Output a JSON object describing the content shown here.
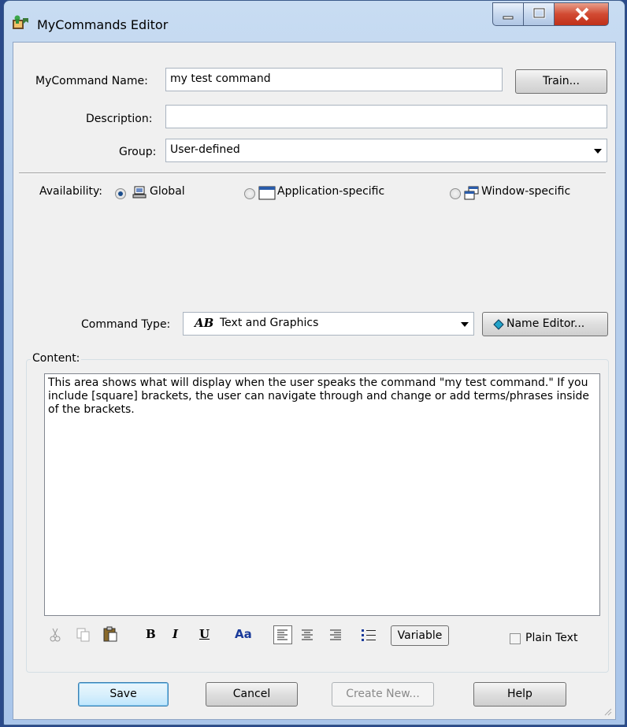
{
  "window": {
    "title": "MyCommands Editor",
    "minimize": "–",
    "maximize": "□",
    "close": "X"
  },
  "form": {
    "name_label": "MyCommand Name:",
    "name_value": "my test command",
    "train_button": "Train...",
    "description_label": "Description:",
    "description_value": "",
    "group_label": "Group:",
    "group_value": "User-defined"
  },
  "availability": {
    "label": "Availability:",
    "options": [
      {
        "label": "Global",
        "selected": true
      },
      {
        "label": "Application-specific",
        "selected": false
      },
      {
        "label": "Window-specific",
        "selected": false
      }
    ]
  },
  "command_type": {
    "label": "Command Type:",
    "icon_text": "AB",
    "value": "Text and Graphics",
    "name_editor_button": "Name Editor..."
  },
  "content": {
    "group_label": "Content:",
    "text": "This area shows what will display when the user speaks the command \"my test command.\" If you include [square] brackets, the user can navigate through and change or add terms/phrases inside of the brackets."
  },
  "toolbar": {
    "bold": "B",
    "italic": "I",
    "underline": "U",
    "font": "Aa",
    "variable_button": "Variable",
    "plain_text_label": "Plain Text",
    "plain_text_checked": false
  },
  "buttons": {
    "save": "Save",
    "cancel": "Cancel",
    "create_new": "Create New...",
    "help": "Help"
  },
  "colors": {
    "accent": "#1b4d8c",
    "title_bar": "#b7cfec",
    "close_button": "#d24a32"
  }
}
